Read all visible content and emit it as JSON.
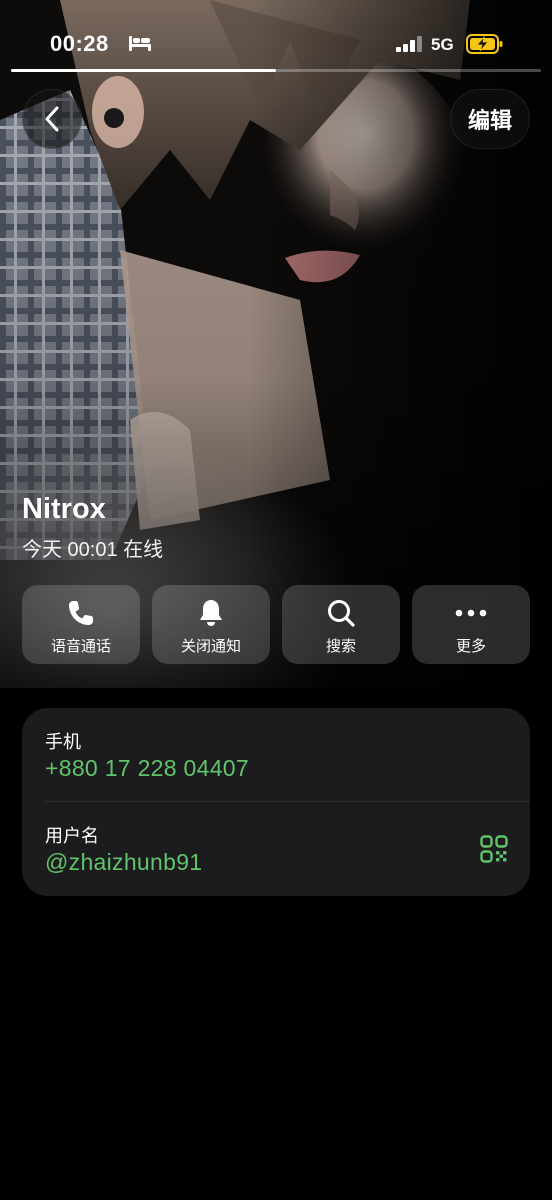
{
  "status_bar": {
    "time": "00:28",
    "network": "5G",
    "sleep_icon": "bed-icon",
    "signal_icon": "signal-bars-icon",
    "battery_icon": "battery-charging-icon",
    "battery_color": "#f5c518"
  },
  "story_progress": {
    "fraction": 0.5
  },
  "header": {
    "back_icon": "chevron-left-icon",
    "edit_label": "编辑"
  },
  "profile": {
    "name": "Nitrox",
    "last_seen": "今天 00:01 在线"
  },
  "actions": [
    {
      "label": "语音通话",
      "icon": "phone-icon"
    },
    {
      "label": "关闭通知",
      "icon": "bell-icon"
    },
    {
      "label": "搜索",
      "icon": "search-icon"
    },
    {
      "label": "更多",
      "icon": "more-dots-icon"
    }
  ],
  "info": {
    "phone_label": "手机",
    "phone_value": "+880 17 228 04407",
    "username_label": "用户名",
    "username_value": "@zhaizhunb91",
    "qr_icon": "qr-code-icon"
  },
  "colors": {
    "accent_green": "#5fc46a",
    "card_bg": "#1c1c1e",
    "background": "#000000"
  }
}
